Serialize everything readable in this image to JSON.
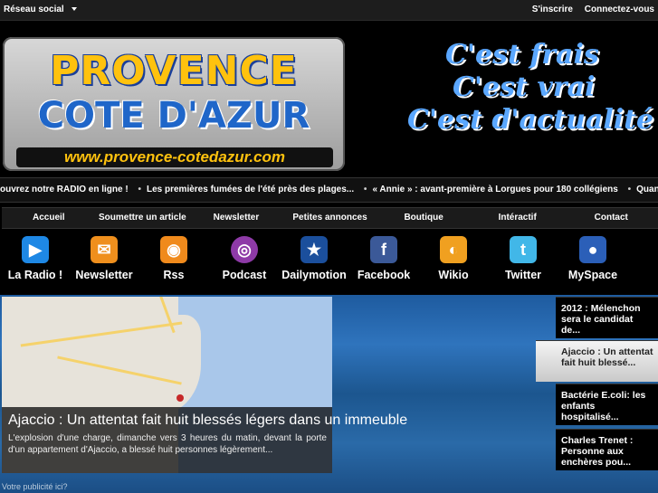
{
  "topbar": {
    "social": "Réseau social",
    "signup": "S'inscrire",
    "login": "Connectez-vous"
  },
  "logo": {
    "line1": "PROVENCE",
    "line2": "COTE D'AZUR",
    "url": "www.provence-cotedazur.com"
  },
  "slogan": [
    "C'est frais",
    "C'est vrai",
    "C'est d'actualité !"
  ],
  "ticker": [
    "ouvrez notre RADIO en ligne !",
    "Les premières fumées de l'été près des plages...",
    "« Annie » : avant-première à Lorgues pour 180 collégiens",
    "Quand l'archéologie"
  ],
  "nav": [
    "Accueil",
    "Soumettre un article",
    "Newsletter",
    "Petites annonces",
    "Boutique",
    "Intéractif",
    "Contact"
  ],
  "icons": [
    {
      "label": "La Radio !",
      "icon": "play-icon",
      "color": "#1e88e5"
    },
    {
      "label": "Newsletter",
      "icon": "mail-icon",
      "color": "#ef8f1d"
    },
    {
      "label": "Rss",
      "icon": "rss-icon",
      "color": "#f08a1c"
    },
    {
      "label": "Podcast",
      "icon": "podcast-icon",
      "color": "#8e3aa7"
    },
    {
      "label": "Dailymotion",
      "icon": "dailymotion-icon",
      "color": "#1b4f9c"
    },
    {
      "label": "Facebook",
      "icon": "facebook-icon",
      "color": "#3b5998"
    },
    {
      "label": "Wikio",
      "icon": "wikio-icon",
      "color": "#f0a020"
    },
    {
      "label": "Twitter",
      "icon": "twitter-icon",
      "color": "#41b7e8"
    },
    {
      "label": "MySpace",
      "icon": "myspace-icon",
      "color": "#2b5fb8"
    }
  ],
  "feature": {
    "title": "Ajaccio : Un attentat fait huit blessés légers dans un immeuble",
    "text": "L'explosion d'une charge, dimanche vers 3 heures du matin, devant la porte d'un appartement d'Ajaccio, a blessé huit personnes légèrement..."
  },
  "side": [
    "2012 : Mélenchon sera le candidat de...",
    "Ajaccio : Un attentat fait huit blessé...",
    "Bactérie E.coli: les enfants hospitalisé...",
    "Charles Trenet : Personne aux enchères pou..."
  ],
  "bottom": "Votre publicité ici?"
}
